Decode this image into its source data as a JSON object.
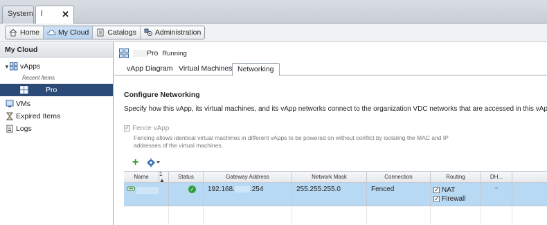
{
  "window_tabs": [
    {
      "label": "System"
    },
    {
      "label": "l",
      "close": "✕"
    }
  ],
  "nav": {
    "buttons": [
      {
        "label": "Home",
        "icon": "home-icon"
      },
      {
        "label": "My Cloud",
        "icon": "cloud-icon",
        "active": true
      },
      {
        "label": "Catalogs",
        "icon": "catalog-icon"
      },
      {
        "label": "Administration",
        "icon": "admin-icon"
      }
    ]
  },
  "sidebar": {
    "title": "My Cloud",
    "vapps_label": "vApps",
    "recent_label": "Recent Items",
    "selected_item": "Pro",
    "items": [
      {
        "label": "VMs",
        "icon": "vm-icon"
      },
      {
        "label": "Expired Items",
        "icon": "hourglass-icon"
      },
      {
        "label": "Logs",
        "icon": "logs-icon"
      }
    ]
  },
  "vapp": {
    "name_suffix": "Pro",
    "status": "Running"
  },
  "subtabs": [
    {
      "label": "vApp Diagram"
    },
    {
      "label": "Virtual Machines"
    },
    {
      "label": "Networking",
      "active": true
    }
  ],
  "networking": {
    "title": "Configure Networking",
    "description": "Specify how this vApp, its virtual machines, and its vApp networks connect to the organization VDC networks that are accessed in this vApp.",
    "fence_label": "Fence vApp",
    "fence_help": "Fencing allows identical virtual machines in different vApps to be powered on without conflict by isolating the MAC and IP addresses of the virtual machines."
  },
  "table": {
    "headers": {
      "name": "Name",
      "sort": "1 ▲",
      "status": "Status",
      "gateway": "Gateway Address",
      "mask": "Network Mask",
      "connection": "Connection",
      "routing": "Routing",
      "dh": "DH..."
    },
    "row": {
      "gateway_prefix": "192.168.",
      "gateway_suffix": ".254",
      "mask": "255.255.255.0",
      "connection": "Fenced",
      "routing_nat": "NAT",
      "routing_firewall": "Firewall",
      "dh": "–"
    }
  },
  "colors": {
    "selected": "#2b4a78",
    "row_highlight": "#b8d9f3",
    "status_ok": "#2f9e3a",
    "add": "#2c9a2c"
  }
}
